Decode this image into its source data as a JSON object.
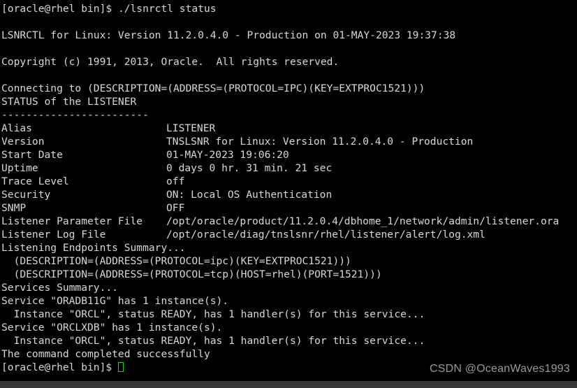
{
  "terminal": {
    "prompt": "[oracle@rhel bin]$ ",
    "command": "./lsnrctl status",
    "banner_version": "LSNRCTL for Linux: Version 11.2.0.4.0 - Production on 01-MAY-2023 19:37:38",
    "copyright": "Copyright (c) 1991, 2013, Oracle.  All rights reserved.",
    "connecting": "Connecting to (DESCRIPTION=(ADDRESS=(PROTOCOL=IPC)(KEY=EXTPROC1521)))",
    "status_header": "STATUS of the LISTENER",
    "separator": "------------------------",
    "details": [
      {
        "key": "Alias",
        "value": "LISTENER"
      },
      {
        "key": "Version",
        "value": "TNSLSNR for Linux: Version 11.2.0.4.0 - Production"
      },
      {
        "key": "Start Date",
        "value": "01-MAY-2023 19:06:20"
      },
      {
        "key": "Uptime",
        "value": "0 days 0 hr. 31 min. 21 sec"
      },
      {
        "key": "Trace Level",
        "value": "off"
      },
      {
        "key": "Security",
        "value": "ON: Local OS Authentication"
      },
      {
        "key": "SNMP",
        "value": "OFF"
      },
      {
        "key": "Listener Parameter File",
        "value": "/opt/oracle/product/11.2.0.4/dbhome_1/network/admin/listener.ora"
      },
      {
        "key": "Listener Log File",
        "value": "/opt/oracle/diag/tnslsnr/rhel/listener/alert/log.xml"
      }
    ],
    "endpoints_header": "Listening Endpoints Summary...",
    "endpoints": [
      "  (DESCRIPTION=(ADDRESS=(PROTOCOL=ipc)(KEY=EXTPROC1521)))",
      "  (DESCRIPTION=(ADDRESS=(PROTOCOL=tcp)(HOST=rhel)(PORT=1521)))"
    ],
    "services_header": "Services Summary...",
    "services": [
      "Service \"ORADB11G\" has 1 instance(s).",
      "  Instance \"ORCL\", status READY, has 1 handler(s) for this service...",
      "Service \"ORCLXDB\" has 1 instance(s).",
      "  Instance \"ORCL\", status READY, has 1 handler(s) for this service..."
    ],
    "completion": "The command completed successfully",
    "final_prompt": "[oracle@rhel bin]$ ",
    "cursor": "block-cursor",
    "colors": {
      "background": "#000000",
      "foreground": "#d8d8d8",
      "cursor": "#24d024",
      "watermark": "#9a9a9a",
      "bottom_bar": "#3a3a3a"
    }
  },
  "watermark": {
    "text": "CSDN @OceanWaves1993"
  }
}
